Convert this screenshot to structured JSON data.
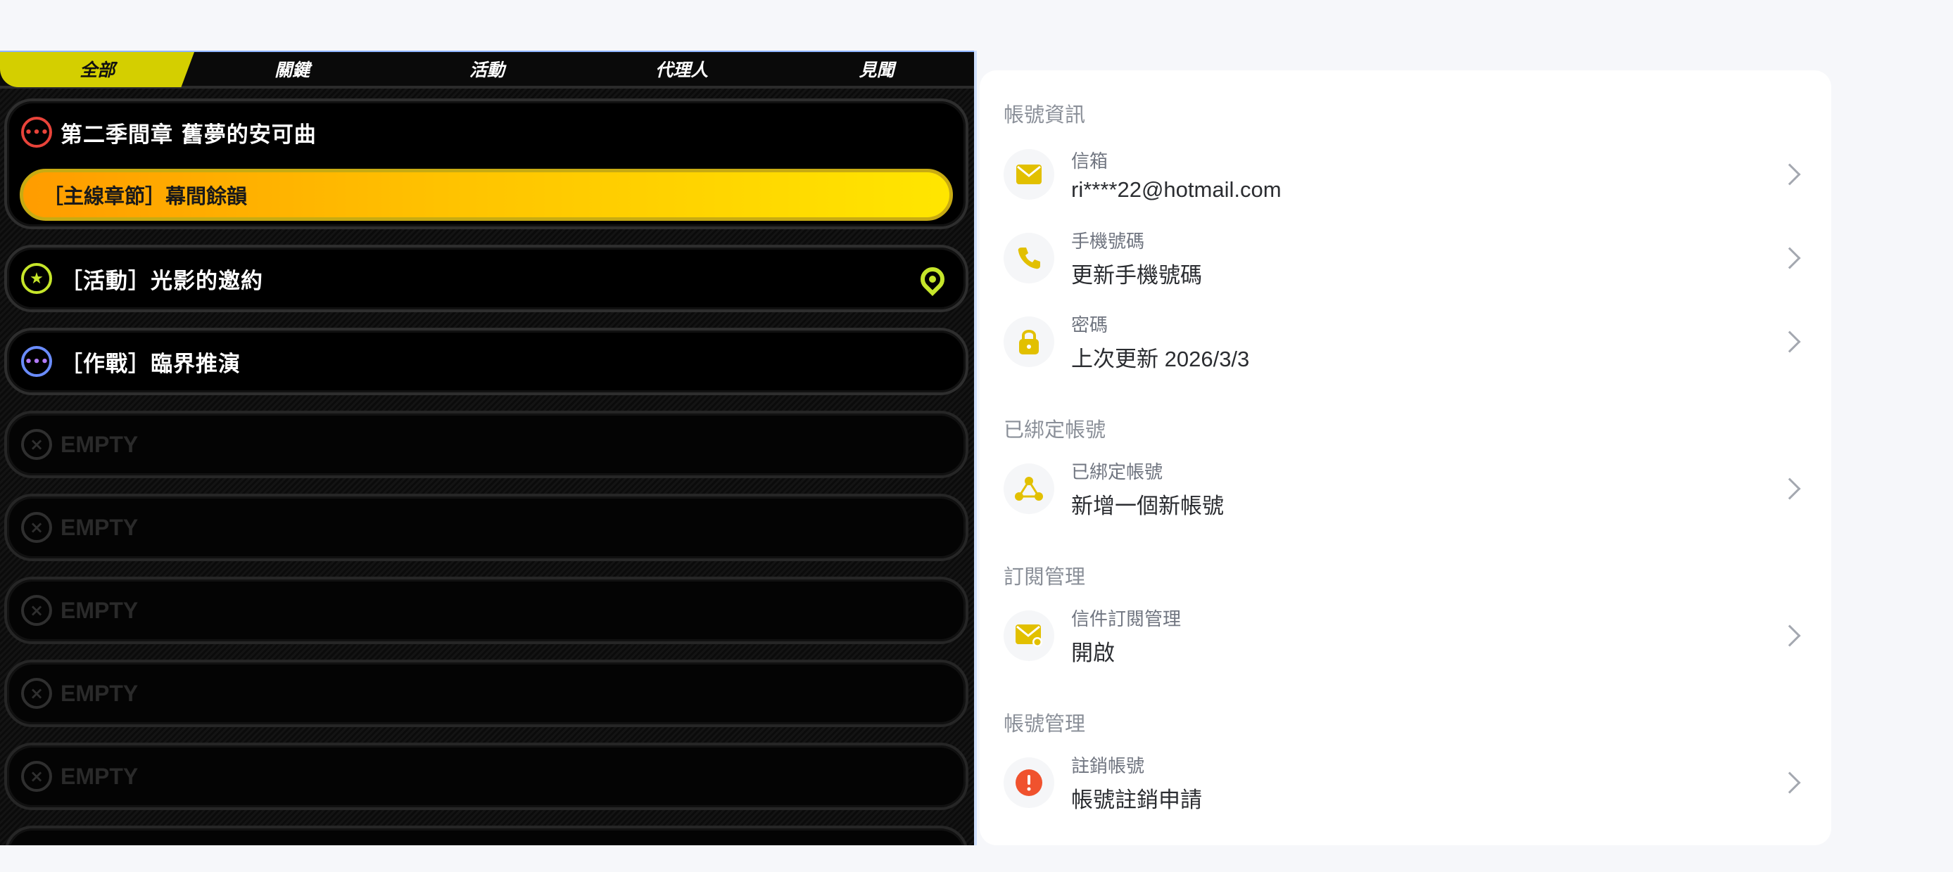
{
  "game": {
    "tabs": [
      "全部",
      "關鍵",
      "活動",
      "代理人",
      "見聞"
    ],
    "active_tab": 0,
    "quests": [
      {
        "kind": "main",
        "icon": "dots-red-icon",
        "title": "第二季間章 舊夢的安可曲",
        "sub": "［主線章節］幕間餘韻"
      },
      {
        "kind": "single",
        "icon": "star-green-icon",
        "title": "［活動］光影的邀約",
        "pinned": true
      },
      {
        "kind": "single",
        "icon": "dots-blue-icon",
        "title": "［作戰］臨界推演"
      },
      {
        "kind": "empty",
        "title": "EMPTY"
      },
      {
        "kind": "empty",
        "title": "EMPTY"
      },
      {
        "kind": "empty",
        "title": "EMPTY"
      },
      {
        "kind": "empty",
        "title": "EMPTY"
      },
      {
        "kind": "empty",
        "title": "EMPTY"
      }
    ]
  },
  "account": {
    "sections": {
      "info": "帳號資訊",
      "linked": "已綁定帳號",
      "subscription": "訂閱管理",
      "management": "帳號管理"
    },
    "email": {
      "label": "信箱",
      "value": "ri****22@hotmail.com"
    },
    "phone": {
      "label": "手機號碼",
      "value": "更新手機號碼"
    },
    "password": {
      "label": "密碼",
      "value": "上次更新 2026/3/3"
    },
    "linked_account": {
      "label": "已綁定帳號",
      "value": "新增一個新帳號"
    },
    "mail_subscription": {
      "label": "信件訂閱管理",
      "value": "開啟"
    },
    "delete_account": {
      "label": "註銷帳號",
      "value": "帳號註銷申請"
    }
  },
  "colors": {
    "accent_yellow": "#e2c000",
    "tab_active": "#d4cf00",
    "danger": "#f0522e"
  }
}
